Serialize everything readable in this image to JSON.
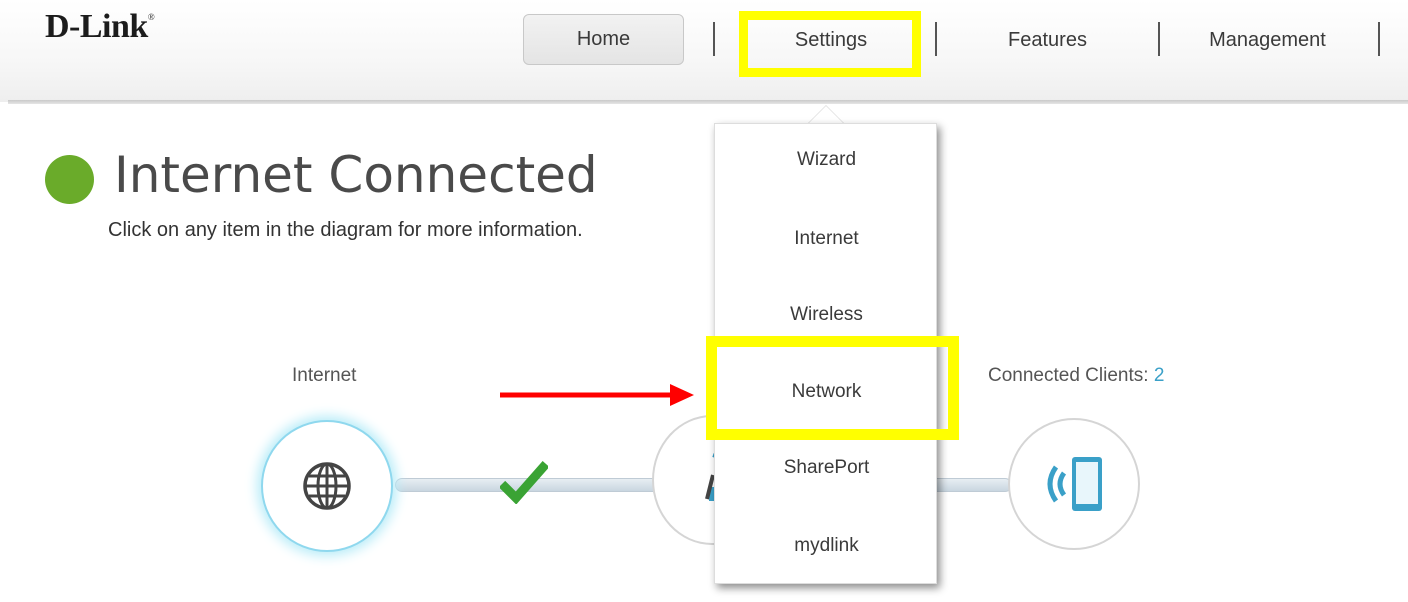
{
  "header": {
    "logo": "D-Link",
    "logo_mark": "®",
    "nav": {
      "home": "Home",
      "settings": "Settings",
      "features": "Features",
      "management": "Management"
    }
  },
  "status": {
    "title": "Internet Connected",
    "subtitle": "Click on any item in the diagram for more information.",
    "color": "#6aab2a"
  },
  "diagram": {
    "internet_label": "Internet",
    "clients_label": "Connected Clients: ",
    "clients_count": "2",
    "icons": {
      "internet": "globe-icon",
      "router": "router-icon",
      "clients": "tablet-icon",
      "status": "checkmark-icon"
    }
  },
  "settings_menu": {
    "items": [
      "Wizard",
      "Internet",
      "Wireless",
      "Network",
      "SharePort",
      "mydlink"
    ]
  },
  "annotations": {
    "highlight_color": "#ffff00",
    "arrow_color": "#ff0000"
  }
}
